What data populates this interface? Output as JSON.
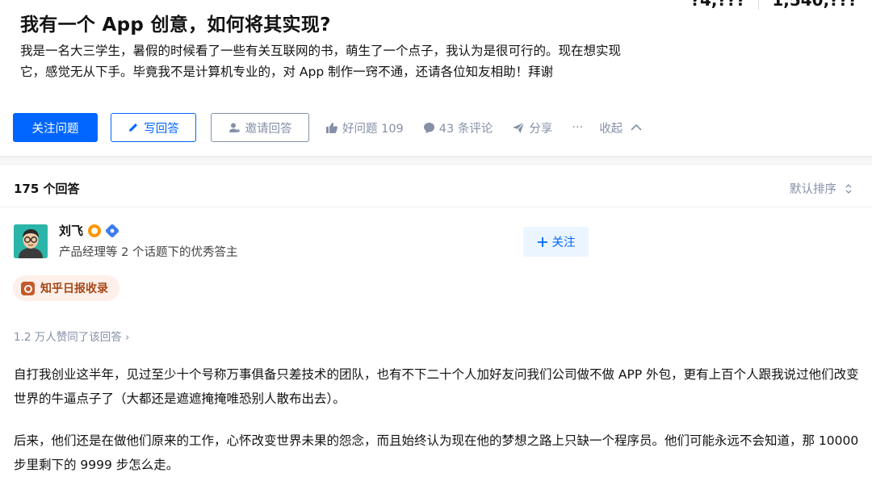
{
  "question": {
    "partial_stats": [
      "?4,???",
      "1,540,???"
    ],
    "title": "我有一个 App 创意，如何将其实现?",
    "description": "我是一名大三学生，暑假的时候看了一些有关互联网的书，萌生了一个点子，我认为是很可行的。现在想实现它，感觉无从下手。毕竟我不是计算机专业的，对 App 制作一窍不通，还请各位知友相助！拜谢"
  },
  "actions": {
    "follow_question": "关注问题",
    "write_answer": "写回答",
    "invite_answer": "邀请回答",
    "good_question": "好问题 109",
    "comments": "43 条评论",
    "share": "分享",
    "more": "···",
    "collapse": "收起"
  },
  "answers": {
    "count_label": "175 个回答",
    "sort_label": "默认排序"
  },
  "author": {
    "name": "刘飞",
    "description": "产品经理等 2 个话题下的优秀答主",
    "follow_label": "关注"
  },
  "answer": {
    "daily_tag": "知乎日报收录",
    "upvote_text": "1.2 万人赞同了该回答 ›",
    "paragraphs": [
      "自打我创业这半年，见过至少十个号称万事俱备只差技术的团队，也有不下二十个人加好友问我们公司做不做 APP 外包，更有上百个人跟我说过他们改变世界的牛逼点子了（大都还是遮遮掩掩唯恐别人散布出去）。",
      "后来，他们还是在做他们原来的工作，心怀改变世界未果的怨念，而且始终认为现在他的梦想之路上只缺一个程序员。他们可能永远不会知道，那 10000 步里剩下的 9999 步怎么走。"
    ]
  },
  "colors": {
    "brand_blue": "#0066ff",
    "meta_gray": "#8590a6",
    "daily_tag_bg": "#fdf0ea",
    "daily_tag_text": "#a64718"
  }
}
